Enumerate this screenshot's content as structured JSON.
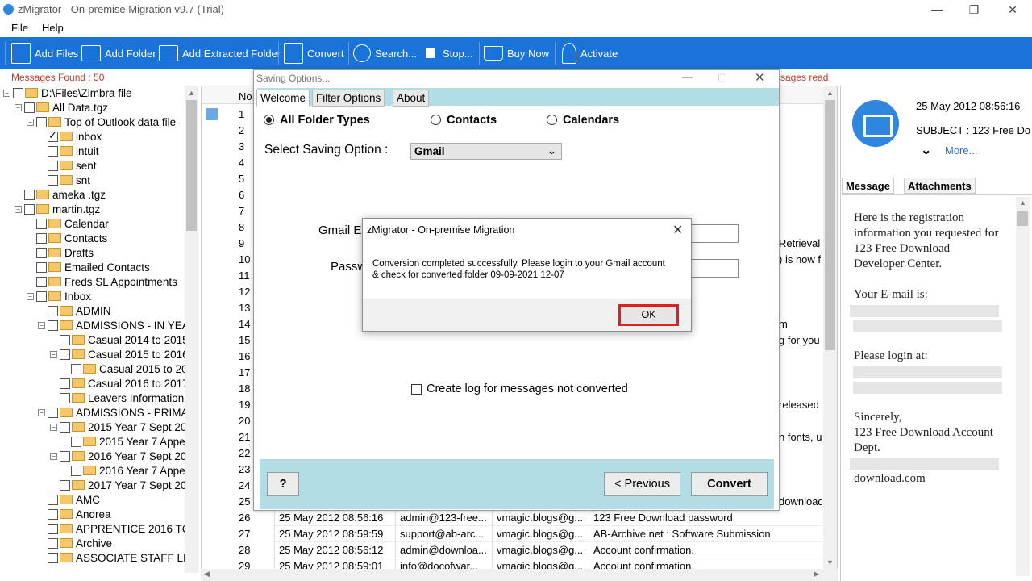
{
  "window": {
    "title": "zMigrator - On-premise Migration v9.7 (Trial)",
    "minimize": "—",
    "maximize": "❐",
    "close": "✕"
  },
  "menu": {
    "file": "File",
    "help": "Help"
  },
  "toolbar": {
    "add_files": "Add Files",
    "add_folder": "Add Folder",
    "add_extracted_folder": "Add Extracted Folder",
    "convert": "Convert",
    "search": "Search...",
    "stop": "Stop...",
    "buy_now": "Buy Now",
    "activate": "Activate",
    "color": "#1a73d9"
  },
  "status": {
    "messages_found": "Messages Found : 50",
    "messages_read": "ssages read"
  },
  "tree": [
    {
      "label": "D:\\Files\\Zimbra file",
      "level": 0,
      "exp": "−",
      "checked": false
    },
    {
      "label": "All Data.tgz",
      "level": 1,
      "exp": "−",
      "checked": false
    },
    {
      "label": "Top of Outlook data file",
      "level": 2,
      "exp": "−",
      "checked": false
    },
    {
      "label": "inbox",
      "level": 3,
      "exp": "",
      "checked": true
    },
    {
      "label": "intuit",
      "level": 3,
      "exp": "",
      "checked": false
    },
    {
      "label": "sent",
      "level": 3,
      "exp": "",
      "checked": false
    },
    {
      "label": "snt",
      "level": 3,
      "exp": "",
      "checked": false
    },
    {
      "label": "ameka .tgz",
      "level": 1,
      "exp": "",
      "checked": false
    },
    {
      "label": "martin.tgz",
      "level": 1,
      "exp": "−",
      "checked": false
    },
    {
      "label": "Calendar",
      "level": 2,
      "exp": "",
      "checked": false
    },
    {
      "label": "Contacts",
      "level": 2,
      "exp": "",
      "checked": false
    },
    {
      "label": "Drafts",
      "level": 2,
      "exp": "",
      "checked": false
    },
    {
      "label": "Emailed Contacts",
      "level": 2,
      "exp": "",
      "checked": false
    },
    {
      "label": "Freds  SL Appointments",
      "level": 2,
      "exp": "",
      "checked": false
    },
    {
      "label": "Inbox",
      "level": 2,
      "exp": "−",
      "checked": false
    },
    {
      "label": "ADMIN",
      "level": 3,
      "exp": "",
      "checked": false
    },
    {
      "label": "ADMISSIONS - IN YEA",
      "level": 3,
      "exp": "−",
      "checked": false
    },
    {
      "label": "Casual 2014 to 2015",
      "level": 4,
      "exp": "",
      "checked": false
    },
    {
      "label": "Casual 2015 to 2016",
      "level": 4,
      "exp": "−",
      "checked": false
    },
    {
      "label": "Casual 2015 to 20",
      "level": 5,
      "exp": "",
      "checked": false
    },
    {
      "label": "Casual 2016 to 2017",
      "level": 4,
      "exp": "",
      "checked": false
    },
    {
      "label": "Leavers Information",
      "level": 4,
      "exp": "",
      "checked": false
    },
    {
      "label": "ADMISSIONS - PRIMA",
      "level": 3,
      "exp": "−",
      "checked": false
    },
    {
      "label": "2015 Year 7 Sept 20",
      "level": 4,
      "exp": "−",
      "checked": false
    },
    {
      "label": "2015 Year 7 Appe",
      "level": 5,
      "exp": "",
      "checked": false
    },
    {
      "label": "2016 Year 7 Sept 20",
      "level": 4,
      "exp": "−",
      "checked": false
    },
    {
      "label": "2016 Year 7 Appe",
      "level": 5,
      "exp": "",
      "checked": false
    },
    {
      "label": "2017 Year 7 Sept 20",
      "level": 4,
      "exp": "",
      "checked": false
    },
    {
      "label": "AMC",
      "level": 3,
      "exp": "",
      "checked": false
    },
    {
      "label": "Andrea",
      "level": 3,
      "exp": "",
      "checked": false
    },
    {
      "label": "APPRENTICE 2016 TC",
      "level": 3,
      "exp": "",
      "checked": false
    },
    {
      "label": "Archive",
      "level": 3,
      "exp": "",
      "checked": false
    },
    {
      "label": "ASSOCIATE STAFF LI",
      "level": 3,
      "exp": "",
      "checked": false
    }
  ],
  "grid": {
    "header_no": "No.",
    "row_numbers": [
      "1",
      "2",
      "3",
      "4",
      "5",
      "6",
      "7",
      "8",
      "9",
      "10",
      "11",
      "12",
      "13",
      "14",
      "15",
      "16",
      "17",
      "18",
      "19",
      "20",
      "21",
      "22",
      "23",
      "24",
      "25",
      "26",
      "27",
      "28",
      "29"
    ],
    "partial_right": [
      {
        "row": 9,
        "text": "Retrieval"
      },
      {
        "row": 10,
        "text": ") is now f"
      },
      {
        "row": 14,
        "text": "m"
      },
      {
        "row": 15,
        "text": "g for you"
      },
      {
        "row": 19,
        "text": "released"
      },
      {
        "row": 21,
        "text": "n fonts, us"
      },
      {
        "row": 25,
        "text": "download"
      }
    ],
    "rows": [
      {
        "no": "26",
        "date": "25 May 2012 08:56:16",
        "from": "admin@123-free...",
        "to": "vmagic.blogs@g...",
        "subject": "123 Free Download password"
      },
      {
        "no": "27",
        "date": "25 May 2012 08:59:59",
        "from": "support@ab-arc...",
        "to": "vmagic.blogs@g...",
        "subject": "AB-Archive.net : Software Submission"
      },
      {
        "no": "28",
        "date": "25 May 2012 08:56:12",
        "from": "admin@downloa...",
        "to": "vmagic.blogs@g...",
        "subject": "Account confirmation."
      },
      {
        "no": "29",
        "date": "25 May 2012 08:59:01",
        "from": "info@docofwar...",
        "to": "vmagic.blogs@g...",
        "subject": "Account confirmation."
      }
    ]
  },
  "preview": {
    "date": "25 May 2012 08:56:16",
    "subject": "SUBJECT : 123 Free Do",
    "more": "More...",
    "tab_message": "Message",
    "tab_attachments": "Attachments",
    "body": {
      "line1": "Here is the registration",
      "line2": "information you requested for",
      "line3": "123 Free Download",
      "line4": "Developer Center.",
      "line5": "Your E-mail is:",
      "line6": "Please login at:",
      "line7": "Sincerely,",
      "line8": "123 Free Download Account",
      "line9": "Dept.",
      "line10": "download.com"
    }
  },
  "saving_dialog": {
    "title": "Saving Options...",
    "tabs": {
      "welcome": "Welcome",
      "filter": "Filter Options",
      "about": "About"
    },
    "radio_all": "All Folder Types",
    "radio_contacts": "Contacts",
    "radio_calendars": "Calendars",
    "select_label": "Select Saving Option  :",
    "select_value": "Gmail",
    "gmail_label": "Gmail E",
    "password_label": "Passw",
    "log_label": "Create log for messages not converted",
    "help_button": "?",
    "previous_button": "<  Previous",
    "convert_button": "Convert"
  },
  "message_box": {
    "title": "zMigrator - On-premise Migration",
    "line1": "Conversion completed successfully. Please login to your Gmail account",
    "line2": "& check for converted folder 09-09-2021 12-07",
    "ok": "OK",
    "highlight_color": "#e02020"
  }
}
